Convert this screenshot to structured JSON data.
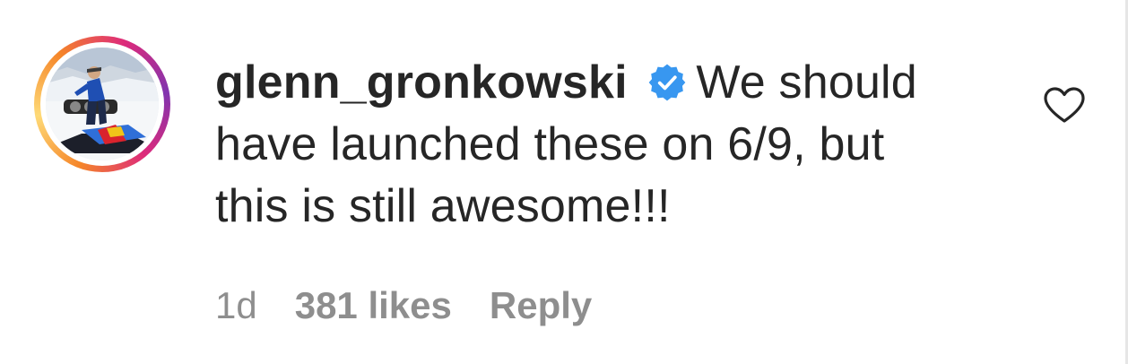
{
  "comment": {
    "username": "glenn_gronkowski",
    "text": "We should have launched these on 6/9, but this is still awesome!!!",
    "verified": true,
    "avatar_icon": "snowmobile-rider-photo",
    "like_icon": "heart-outline-icon"
  },
  "meta": {
    "time": "1d",
    "likes": "381 likes",
    "reply_label": "Reply"
  },
  "colors": {
    "text": "#262626",
    "secondary": "#8e8e8e",
    "verified": "#3897f0",
    "story_ring": [
      "#f58529",
      "#feda77",
      "#dd2a7b",
      "#8134af"
    ]
  }
}
